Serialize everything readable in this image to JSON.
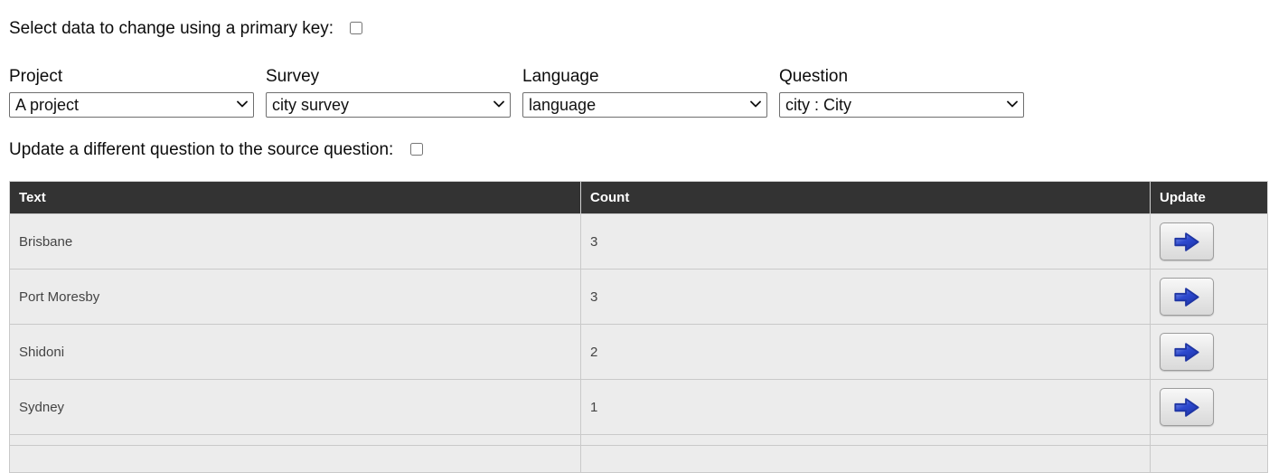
{
  "controls": {
    "primary_key_label": "Select data to change using a primary key:",
    "update_question_label": "Update a different question to the source question:"
  },
  "filters": [
    {
      "label": "Project",
      "value": "A project"
    },
    {
      "label": "Survey",
      "value": "city survey"
    },
    {
      "label": "Language",
      "value": "language"
    },
    {
      "label": "Question",
      "value": "city : City"
    }
  ],
  "table": {
    "columns": [
      "Text",
      "Count",
      "Update"
    ],
    "rows": [
      {
        "text": "Brisbane",
        "count": "3"
      },
      {
        "text": "Port Moresby",
        "count": "3"
      },
      {
        "text": "Shidoni",
        "count": "2"
      },
      {
        "text": "Sydney",
        "count": "1"
      }
    ],
    "update_icon": "arrow-right-icon"
  },
  "colors": {
    "header_bg": "#333333",
    "header_text": "#ffffff",
    "row_bg": "#ececec",
    "row_border": "#c9c9c9",
    "button_border": "#9c9c9c",
    "arrow_blue": "#2d49cf"
  }
}
